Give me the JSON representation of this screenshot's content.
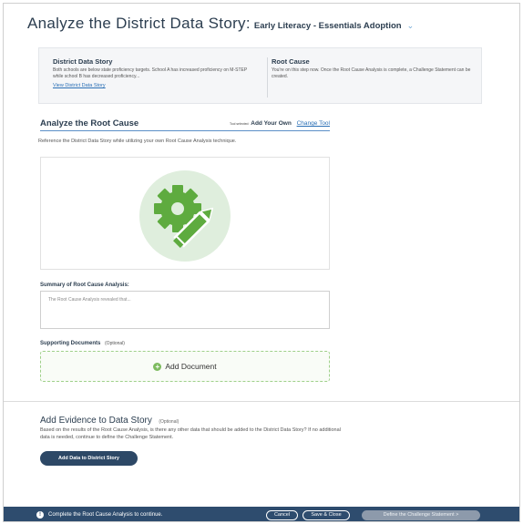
{
  "header": {
    "title": "Analyze the District Data Story:",
    "subtitle": "Early Literacy - Essentials Adoption"
  },
  "story": {
    "district_heading": "District Data Story",
    "district_text": "Both schools are below state proficiency targets. School A has increased proficiency on M-STEP while school B has decreased proficiency...",
    "district_link": "View District Data Story",
    "root_heading": "Root Cause",
    "root_text": "You're on this step now. Once the Root Cause Analysis is complete, a Challenge Statement can be created."
  },
  "analyze": {
    "title": "Analyze the Root Cause",
    "tool_selected_label": "Tool selected:",
    "tool_name": "Add Your Own",
    "change_tool": "Change Tool",
    "description": "Reference the District Data Story while utilizing your own Root Cause Analysis technique."
  },
  "illustration": {
    "icon": "gear-pencil-icon",
    "circle_color": "#dfeedd",
    "gear_color": "#5eab3f",
    "pencil_color": "#5eab3f"
  },
  "summary": {
    "label": "Summary of Root Cause Analysis:",
    "placeholder": "The Root Cause Analysis revealed that..."
  },
  "supporting": {
    "label": "Supporting Documents",
    "optional": "(Optional)",
    "add_label": "Add Document"
  },
  "evidence": {
    "title": "Add Evidence to Data Story",
    "optional": "(Optional)",
    "description": "Based on the results of the Root Cause Analysis, is there any other data that should be added to the District Data Story? If no additional data is needed, continue to define the Challenge Statement.",
    "button": "Add Data to District Story"
  },
  "footer": {
    "message": "Complete the Root Cause Analysis to continue.",
    "cancel": "Cancel",
    "save_close": "Save & Close",
    "define": "Define the Challenge Statement >"
  }
}
